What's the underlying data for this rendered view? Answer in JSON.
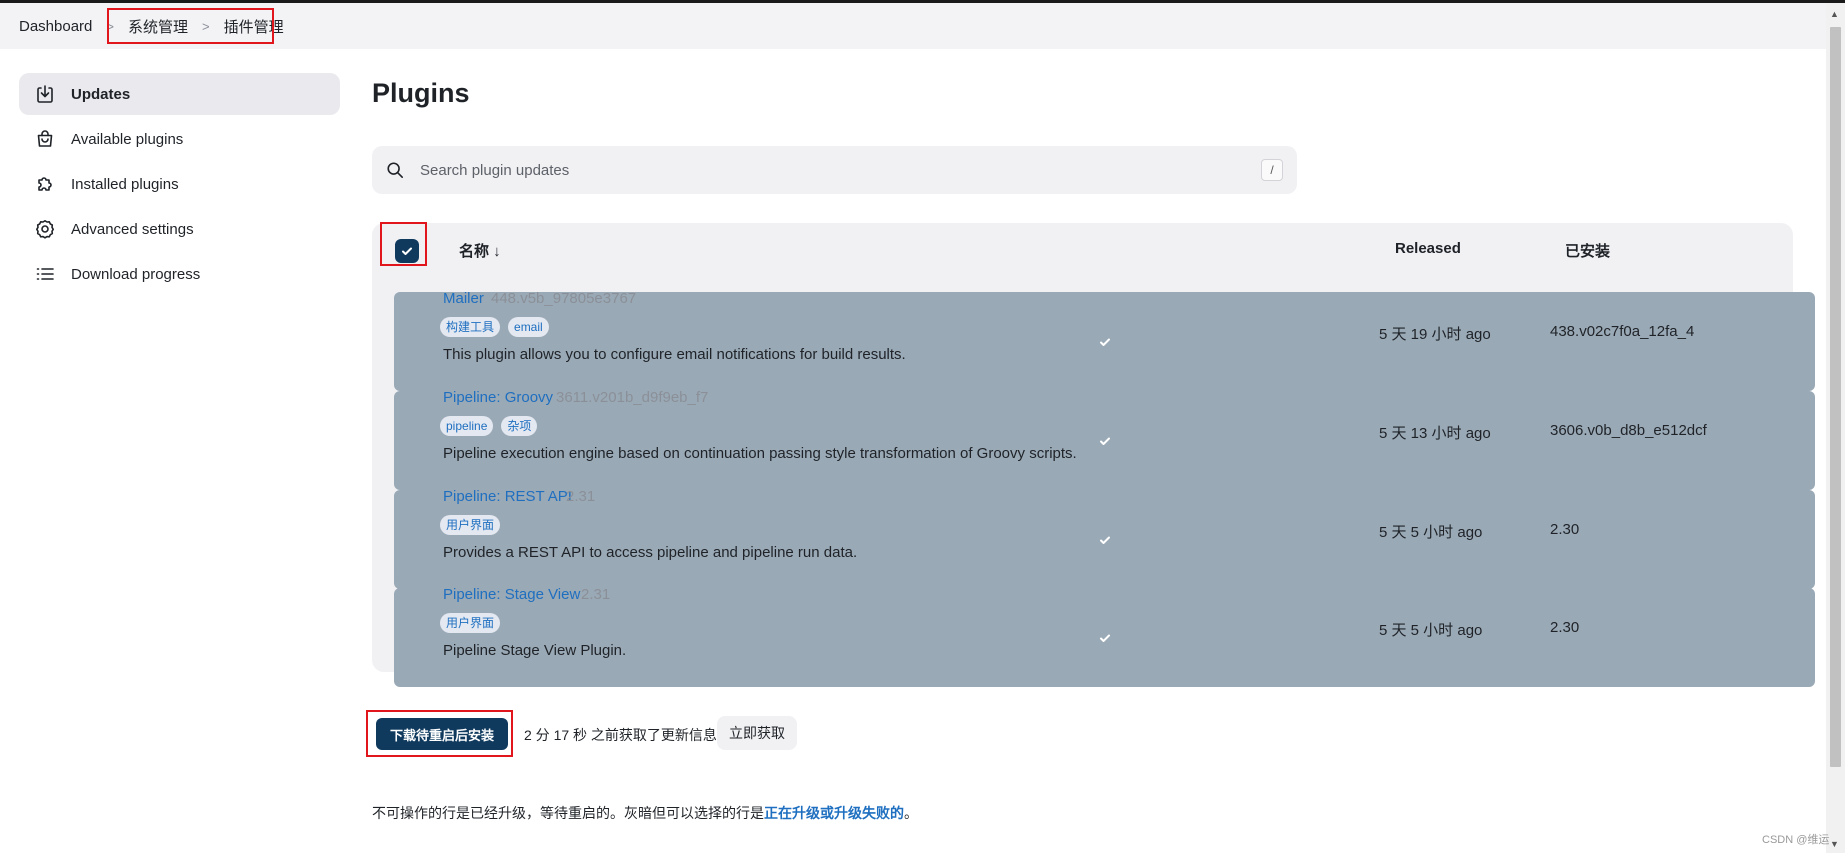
{
  "breadcrumb": {
    "items": [
      "Dashboard",
      "系统管理",
      "插件管理"
    ]
  },
  "sidebar": {
    "items": [
      {
        "label": "Updates",
        "icon": "download-icon",
        "active": true
      },
      {
        "label": "Available plugins",
        "icon": "shopping-bag-icon",
        "active": false
      },
      {
        "label": "Installed plugins",
        "icon": "puzzle-icon",
        "active": false
      },
      {
        "label": "Advanced settings",
        "icon": "gear-icon",
        "active": false
      },
      {
        "label": "Download progress",
        "icon": "list-icon",
        "active": false
      }
    ]
  },
  "page": {
    "title": "Plugins"
  },
  "search": {
    "placeholder": "Search plugin updates",
    "shortcut": "/"
  },
  "table": {
    "headers": {
      "name": "名称 ↓",
      "released": "Released",
      "installed": "已安装"
    },
    "select_all_checked": true,
    "rows": [
      {
        "name": "Mailer",
        "version": "448.v5b_97805e3767",
        "tags": [
          "构建工具",
          "email"
        ],
        "description": "This plugin allows you to configure email notifications for build results.",
        "released": "5 天 19 小时 ago",
        "installed": "438.v02c7f0a_12fa_4",
        "checked": true
      },
      {
        "name": "Pipeline: Groovy",
        "version": "3611.v201b_d9f9eb_f7",
        "tags": [
          "pipeline",
          "杂项"
        ],
        "description": "Pipeline execution engine based on continuation passing style transformation of Groovy scripts.",
        "released": "5 天 13 小时 ago",
        "installed": "3606.v0b_d8b_e512dcf",
        "checked": true
      },
      {
        "name": "Pipeline: REST API",
        "version": "2.31",
        "tags": [
          "用户界面"
        ],
        "description": "Provides a REST API to access pipeline and pipeline run data.",
        "released": "5 天 5 小时 ago",
        "installed": "2.30",
        "checked": true
      },
      {
        "name": "Pipeline: Stage View",
        "version": "2.31",
        "tags": [
          "用户界面"
        ],
        "description": "Pipeline Stage View Plugin.",
        "released": "5 天 5 小时 ago",
        "installed": "2.30",
        "checked": true
      }
    ]
  },
  "actions": {
    "download_button": "下载待重启后安装",
    "update_info": "2 分 17 秒 之前获取了更新信息",
    "check_now_button": "立即获取"
  },
  "footnote": {
    "text": "不可操作的行是已经升级，等待重启的。灰暗但可以选择的行是",
    "link": "正在升级或升级失败的",
    "end": "。"
  },
  "watermark": "CSDN @维运",
  "colors": {
    "primary": "#0f3a5e",
    "link": "#1f6fc0",
    "highlight_box": "#e0161c",
    "panel_bg": "#f1f1f4"
  }
}
